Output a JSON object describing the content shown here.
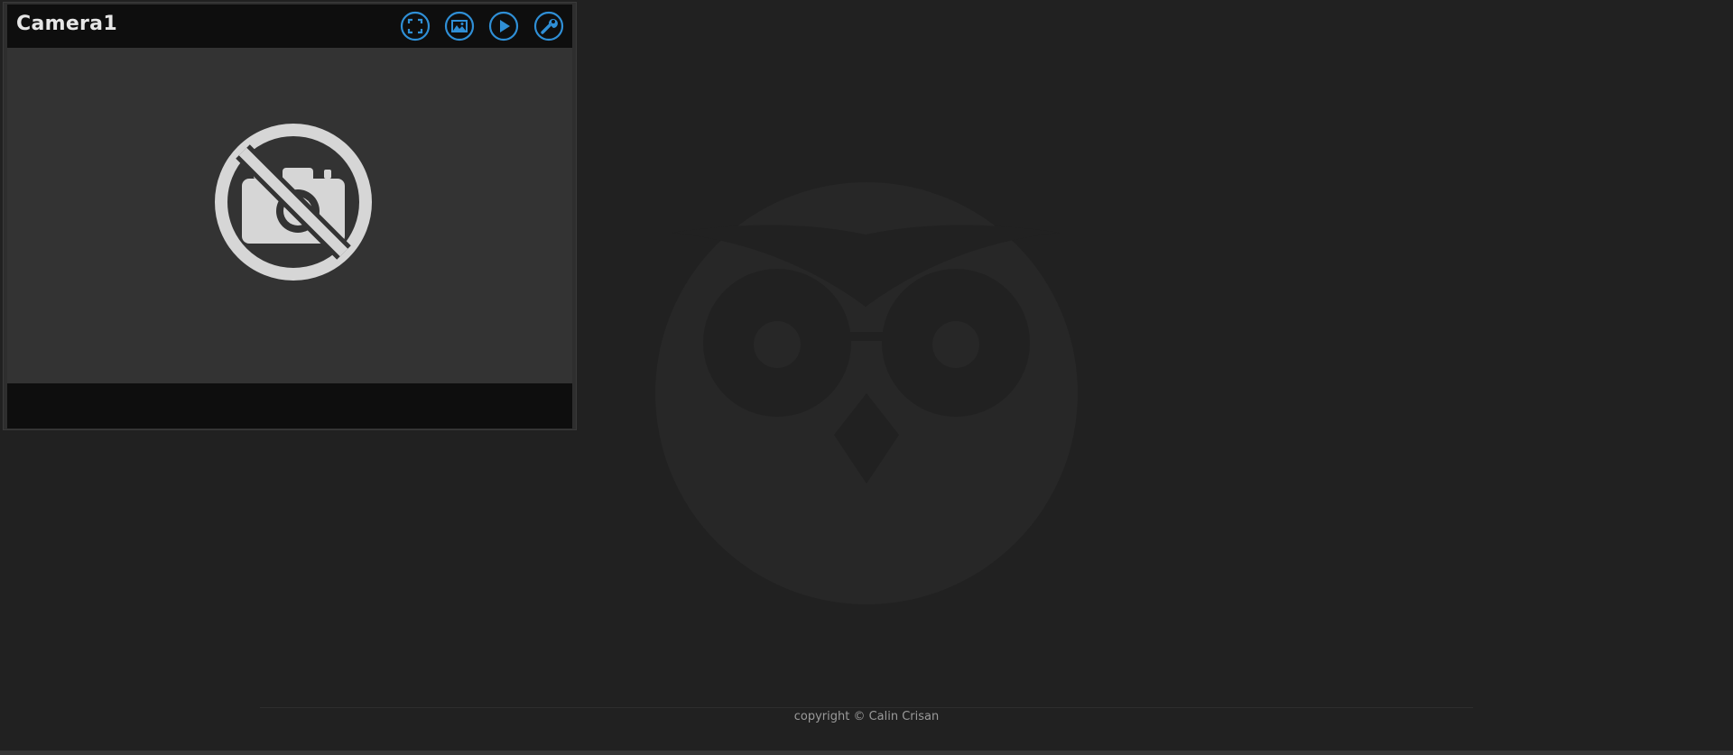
{
  "camera": {
    "name": "Camera1",
    "buttons": [
      {
        "name": "fullscreen-button",
        "icon": "fullscreen-icon"
      },
      {
        "name": "pictures-button",
        "icon": "picture-icon"
      },
      {
        "name": "movies-button",
        "icon": "play-icon"
      },
      {
        "name": "configure-button",
        "icon": "wrench-icon"
      }
    ],
    "status_icon": "no-camera-icon"
  },
  "footer": {
    "copyright": "copyright © Calin Crisan"
  },
  "background": {
    "logo_icon": "owl-logo-icon"
  },
  "colors": {
    "page_background": "#212121",
    "frame_background": "#333333",
    "bar_background": "#0e0e0e",
    "accent": "#2f8fd6",
    "icon_light": "#d6d6d6"
  }
}
